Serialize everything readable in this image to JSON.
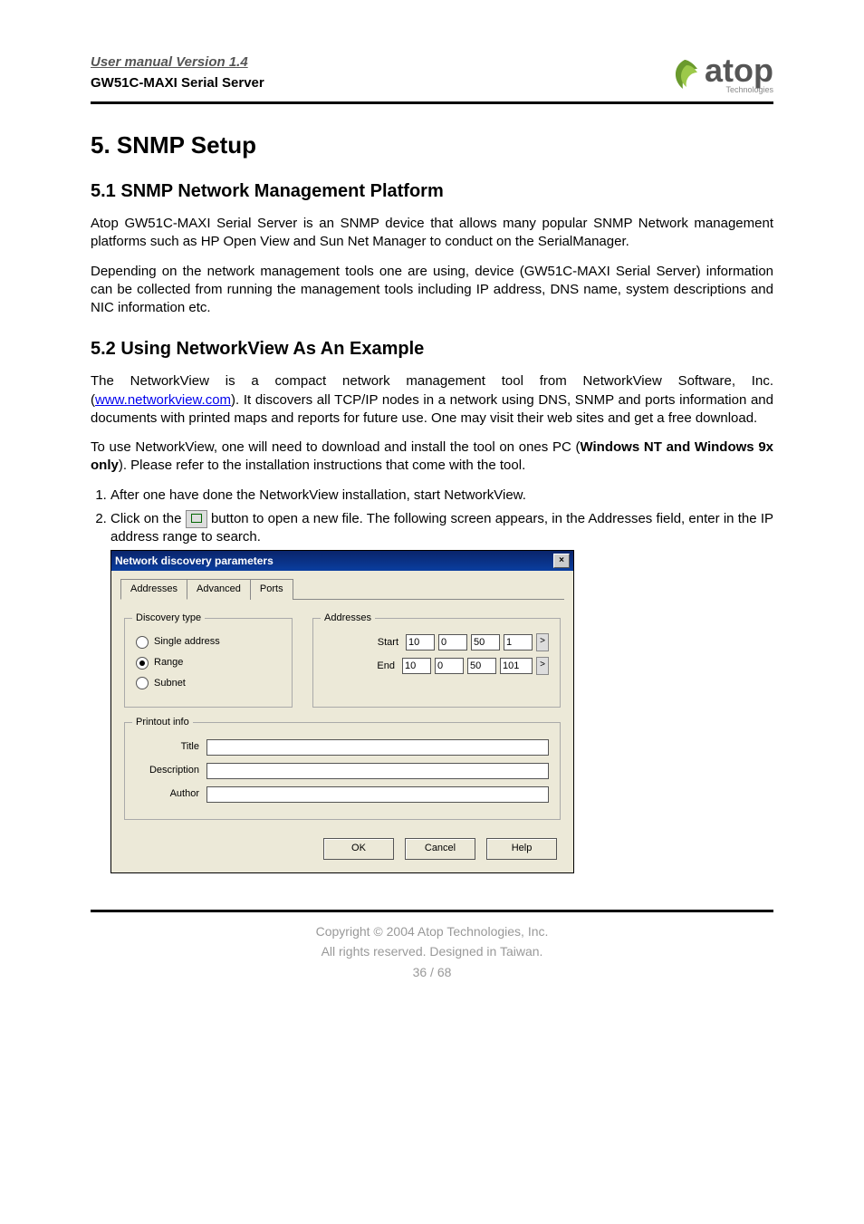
{
  "header": {
    "title": "User manual Version 1.4",
    "subtitle": "GW51C-MAXI Serial Server",
    "logo_text": "atop",
    "logo_sub": "Technologies"
  },
  "section": {
    "h1": "5. SNMP Setup",
    "h2a": "5.1 SNMP Network Management Platform",
    "p1": "Atop GW51C-MAXI Serial Server is an SNMP device that allows many popular SNMP Network management platforms such as HP Open View and Sun Net Manager to conduct on the SerialManager.",
    "p2": "Depending on the network management tools one are using, device (GW51C-MAXI Serial Server) information can be collected from running the management tools including IP address, DNS name, system descriptions and NIC information etc.",
    "h2b": "5.2 Using NetworkView As An Example",
    "p3a": "The NetworkView is a compact network management tool from NetworkView Software, Inc. (",
    "p3_link": "www.networkview.com",
    "p3b": "). It discovers all TCP/IP nodes in a network using DNS, SNMP and ports information and documents with printed maps and reports for future use. One may visit their web sites and get a free download.",
    "p4a": "To use NetworkView, one will need to download and install the tool on ones PC (",
    "p4_bold": "Windows NT and Windows 9x only",
    "p4b": "). Please refer to the installation instructions that come with the tool.",
    "li1": "After one have done the NetworkView installation, start NetworkView.",
    "li2a": "Click on the ",
    "li2b": " button to open a new file. The following screen appears, in the Addresses field, enter in the IP address range to search."
  },
  "dialog": {
    "title": "Network discovery parameters",
    "close": "×",
    "tabs": [
      "Addresses",
      "Advanced",
      "Ports"
    ],
    "discovery_legend": "Discovery type",
    "radios": {
      "single": "Single address",
      "range": "Range",
      "subnet": "Subnet"
    },
    "addresses_legend": "Addresses",
    "start_label": "Start",
    "end_label": "End",
    "start_ip": [
      "10",
      "0",
      "50",
      "1"
    ],
    "end_ip": [
      "10",
      "0",
      "50",
      "101"
    ],
    "spin": ">",
    "printout_legend": "Printout info",
    "fields": {
      "title": "Title",
      "description": "Description",
      "author": "Author"
    },
    "buttons": {
      "ok": "OK",
      "cancel": "Cancel",
      "help": "Help"
    }
  },
  "footer": {
    "line1": "Copyright © 2004 Atop Technologies, Inc.",
    "line2": "All rights reserved. Designed in Taiwan.",
    "page": "36 / 68"
  }
}
